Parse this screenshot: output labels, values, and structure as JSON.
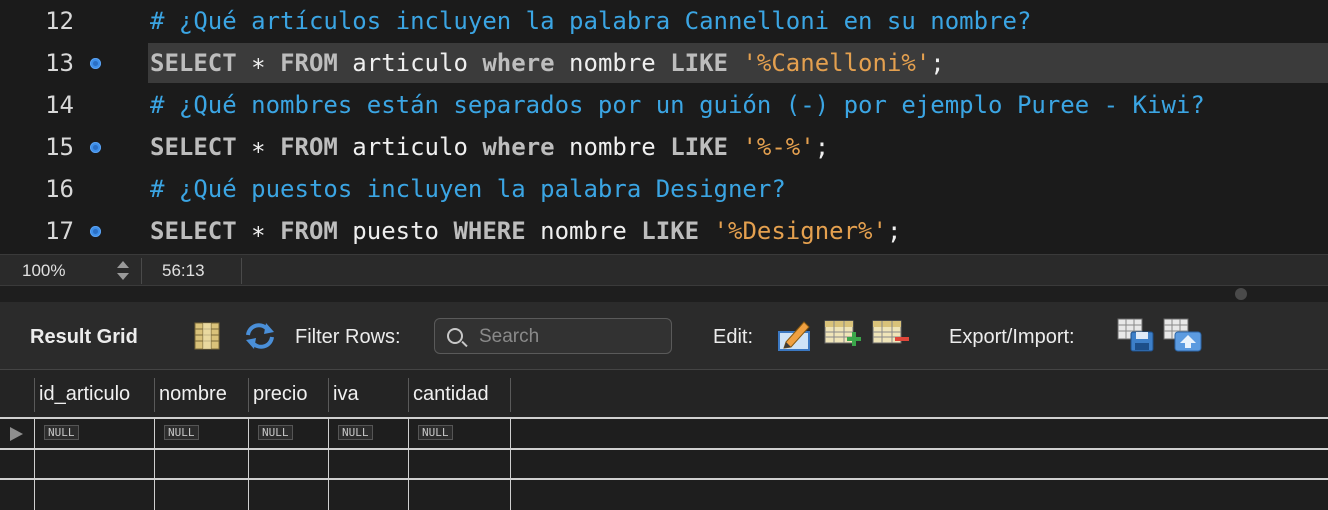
{
  "editor": {
    "lines": [
      {
        "number": "12",
        "marker": false,
        "current": false,
        "tokens": [
          {
            "type": "comment",
            "text": "# ¿Qué artículos incluyen la palabra Cannelloni en su nombre?"
          }
        ]
      },
      {
        "number": "13",
        "marker": true,
        "current": true,
        "tokens": [
          {
            "type": "kw",
            "text": "SELECT"
          },
          {
            "type": "id",
            "text": " ∗ "
          },
          {
            "type": "kw",
            "text": "FROM"
          },
          {
            "type": "id",
            "text": " articulo "
          },
          {
            "type": "kw",
            "text": "where"
          },
          {
            "type": "id",
            "text": " nombre "
          },
          {
            "type": "kw",
            "text": "LIKE"
          },
          {
            "type": "id",
            "text": " "
          },
          {
            "type": "str",
            "text": "'%Canelloni%'"
          },
          {
            "type": "punc",
            "text": ";"
          }
        ]
      },
      {
        "number": "14",
        "marker": false,
        "current": false,
        "tokens": [
          {
            "type": "comment",
            "text": "# ¿Qué nombres están separados por un guión (-) por ejemplo Puree - Kiwi?"
          }
        ]
      },
      {
        "number": "15",
        "marker": true,
        "current": false,
        "tokens": [
          {
            "type": "kw",
            "text": "SELECT"
          },
          {
            "type": "id",
            "text": " ∗ "
          },
          {
            "type": "kw",
            "text": "FROM"
          },
          {
            "type": "id",
            "text": " articulo "
          },
          {
            "type": "kw",
            "text": "where"
          },
          {
            "type": "id",
            "text": " nombre "
          },
          {
            "type": "kw",
            "text": "LIKE"
          },
          {
            "type": "id",
            "text": " "
          },
          {
            "type": "str",
            "text": "'%-%'"
          },
          {
            "type": "punc",
            "text": ";"
          }
        ]
      },
      {
        "number": "16",
        "marker": false,
        "current": false,
        "tokens": [
          {
            "type": "comment",
            "text": "# ¿Qué puestos incluyen la palabra Designer?"
          }
        ]
      },
      {
        "number": "17",
        "marker": true,
        "current": false,
        "tokens": [
          {
            "type": "kw",
            "text": "SELECT"
          },
          {
            "type": "id",
            "text": " ∗ "
          },
          {
            "type": "kw",
            "text": "FROM"
          },
          {
            "type": "id",
            "text": " puesto "
          },
          {
            "type": "kw",
            "text": "WHERE"
          },
          {
            "type": "id",
            "text": " nombre "
          },
          {
            "type": "kw",
            "text": "LIKE"
          },
          {
            "type": "id",
            "text": " "
          },
          {
            "type": "str",
            "text": "'%Designer%'"
          },
          {
            "type": "punc",
            "text": ";"
          }
        ]
      }
    ]
  },
  "status": {
    "zoom": "100%",
    "cursor_position": "56:13"
  },
  "result_toolbar": {
    "title": "Result Grid",
    "filter_label": "Filter Rows:",
    "search_placeholder": "Search",
    "edit_label": "Edit:",
    "export_label": "Export/Import:",
    "icons": [
      "grid-layout-icon",
      "refresh-icon",
      "edit-pencil-icon",
      "add-row-icon",
      "delete-row-icon",
      "export-icon",
      "import-icon"
    ]
  },
  "grid": {
    "columns": [
      "id_articulo",
      "nombre",
      "precio",
      "iva",
      "cantidad"
    ],
    "rows": [
      [
        "NULL",
        "NULL",
        "NULL",
        "NULL",
        "NULL"
      ]
    ]
  },
  "colors": {
    "comment": "#3ba5e3",
    "keyword": "#bdbdbd",
    "string": "#e4a04f",
    "marker": "#3d8ee8"
  }
}
